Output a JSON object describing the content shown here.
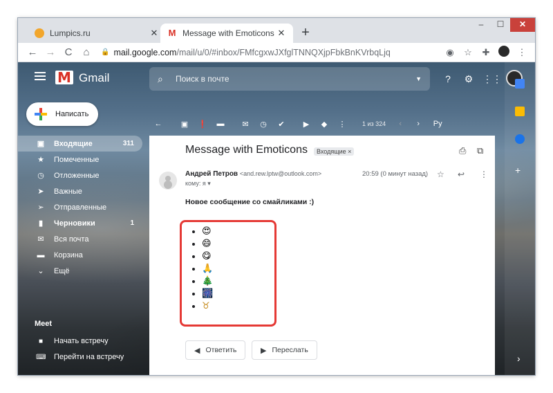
{
  "browser": {
    "tabs": [
      {
        "title": "Lumpics.ru",
        "favicon_color": "#f2a62c",
        "active": false
      },
      {
        "title": "Message with Emoticons - and.re",
        "favicon_color": "#d93025",
        "active": true
      }
    ],
    "window_controls": {
      "minimize": "–",
      "maximize": "☐",
      "close": "✕"
    },
    "url_host": "mail.google.com",
    "url_path": "/mail/u/0/#inbox/FMfcgxwJXfglTNNQXjpFbkBnKVrbqLjq"
  },
  "gmail": {
    "product_name": "Gmail",
    "search_placeholder": "Поиск в почте",
    "compose_label": "Написать",
    "nav_items": [
      {
        "label": "Входящие",
        "count": "311",
        "icon": "inbox-icon",
        "active": true
      },
      {
        "label": "Помеченные",
        "count": "",
        "icon": "star-icon"
      },
      {
        "label": "Отложенные",
        "count": "",
        "icon": "clock-icon"
      },
      {
        "label": "Важные",
        "count": "",
        "icon": "important-icon"
      },
      {
        "label": "Отправленные",
        "count": "",
        "icon": "send-icon"
      },
      {
        "label": "Черновики",
        "count": "1",
        "icon": "draft-icon",
        "bold": true
      },
      {
        "label": "Вся почта",
        "count": "",
        "icon": "all-mail-icon"
      },
      {
        "label": "Корзина",
        "count": "",
        "icon": "trash-icon"
      },
      {
        "label": "Ещё",
        "count": "",
        "icon": "chevron-down-icon"
      }
    ],
    "meet": {
      "title": "Meet",
      "items": [
        {
          "label": "Начать встречу",
          "icon": "video-icon"
        },
        {
          "label": "Перейти на встречу",
          "icon": "keyboard-icon"
        }
      ]
    },
    "pager": "1 из 324",
    "input_language": "Ру"
  },
  "message": {
    "subject": "Message with Emoticons",
    "label": "Входящие ×",
    "sender_name": "Андрей Петров",
    "sender_email": "<and.rew.lptw@outlook.com>",
    "recipient": "кому: я ▾",
    "time": "20:59 (0 минут назад)",
    "body": "Новое сообщение со смайликами :)",
    "emojis": [
      "😍",
      "😄",
      "😋",
      "🙏",
      "🎄",
      "🎆",
      "♉"
    ],
    "reply_label": "Ответить",
    "forward_label": "Переслать"
  },
  "colors": {
    "highlight": "#e53935",
    "gmail_red": "#d93025",
    "close_button": "#c9413b"
  }
}
